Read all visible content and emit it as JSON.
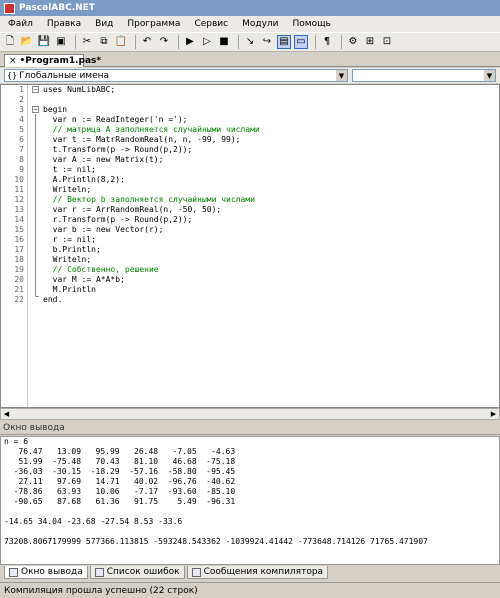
{
  "window": {
    "title": "PascalABC.NET"
  },
  "menu": [
    "Файл",
    "Правка",
    "Вид",
    "Программа",
    "Сервис",
    "Модули",
    "Помощь"
  ],
  "toolbar": [
    {
      "name": "new-file-icon",
      "glyph": "🗋"
    },
    {
      "name": "open-icon",
      "glyph": "📂"
    },
    {
      "name": "save-icon",
      "glyph": "💾"
    },
    {
      "name": "save-all-icon",
      "glyph": "▣"
    },
    {
      "name": "sep"
    },
    {
      "name": "cut-icon",
      "glyph": "✂"
    },
    {
      "name": "copy-icon",
      "glyph": "⧉"
    },
    {
      "name": "paste-icon",
      "glyph": "📋"
    },
    {
      "name": "sep"
    },
    {
      "name": "undo-icon",
      "glyph": "↶"
    },
    {
      "name": "redo-icon",
      "glyph": "↷"
    },
    {
      "name": "sep"
    },
    {
      "name": "run-icon",
      "glyph": "▶"
    },
    {
      "name": "debug-run-icon",
      "glyph": "▷"
    },
    {
      "name": "stop-icon",
      "glyph": "■"
    },
    {
      "name": "sep"
    },
    {
      "name": "step-into-icon",
      "glyph": "↘"
    },
    {
      "name": "step-over-icon",
      "glyph": "↪"
    },
    {
      "name": "layout-toggle-icon",
      "glyph": "▤",
      "pressed": true
    },
    {
      "name": "output-toggle-icon",
      "glyph": "▭",
      "pressed": true
    },
    {
      "name": "sep"
    },
    {
      "name": "format-icon",
      "glyph": "¶"
    },
    {
      "name": "sep"
    },
    {
      "name": "compile-icon",
      "glyph": "⚙"
    },
    {
      "name": "form-icon",
      "glyph": "⊞"
    },
    {
      "name": "designer-icon",
      "glyph": "⊡"
    }
  ],
  "tab": {
    "label": "•Program1.pas*",
    "close_glyph": "×"
  },
  "scope": {
    "label": "Глобальные имена",
    "dd_glyph": "▼"
  },
  "code_lines": [
    {
      "t": "uses NumLibABC;"
    },
    {
      "t": ""
    },
    {
      "t": "begin"
    },
    {
      "t": "  var n := ReadInteger('n =');"
    },
    {
      "t": "  // матрица A заполняется случайными числами",
      "c": true
    },
    {
      "t": "  var t := MatrRandomReal(n, n, -99, 99);"
    },
    {
      "t": "  t.Transform(p -> Round(p,2));"
    },
    {
      "t": "  var A := new Matrix(t);"
    },
    {
      "t": "  t := nil;"
    },
    {
      "t": "  A.Println(8,2);"
    },
    {
      "t": "  Writeln;"
    },
    {
      "t": "  // Вектор b заполняется случайными числами",
      "c": true
    },
    {
      "t": "  var r := ArrRandomReal(n, -50, 50);"
    },
    {
      "t": "  r.Transform(p -> Round(p,2));"
    },
    {
      "t": "  var b := new Vector(r);"
    },
    {
      "t": "  r := nil;"
    },
    {
      "t": "  b.Println;"
    },
    {
      "t": "  Writeln;"
    },
    {
      "t": "  // Собственно, решение",
      "c": true
    },
    {
      "t": "  var M := A*A*b;"
    },
    {
      "t": "  M.Println"
    },
    {
      "t": "end."
    }
  ],
  "output": {
    "header": "Окно вывода",
    "lines": [
      "n = 6",
      "   76.47   13.09   95.99   26.48   -7.05   -4.63",
      "   51.99  -75.48   70.43   81.10   46.68  -75.18",
      "  -36.03  -30.15  -18.29  -57.16  -58.80  -95.45",
      "   27.11   97.69   14.71   40.02  -96.76  -40.62",
      "  -78.86   63.93   10.06   -7.17  -93.60  -85.10",
      "  -90.65   87.68   61.36   91.75    5.49  -96.31",
      "",
      "-14.65 34.04 -23.68 -27.54 8.53 -33.6",
      "",
      "73208.8067179999 577366.113815 -593248.543362 -1039924.41442 -773648.714126 71765.471907"
    ]
  },
  "bottom_tabs": [
    "Окно вывода",
    "Список ошибок",
    "Сообщения компилятора"
  ],
  "status": "Компиляция прошла успешно (22 строк)"
}
